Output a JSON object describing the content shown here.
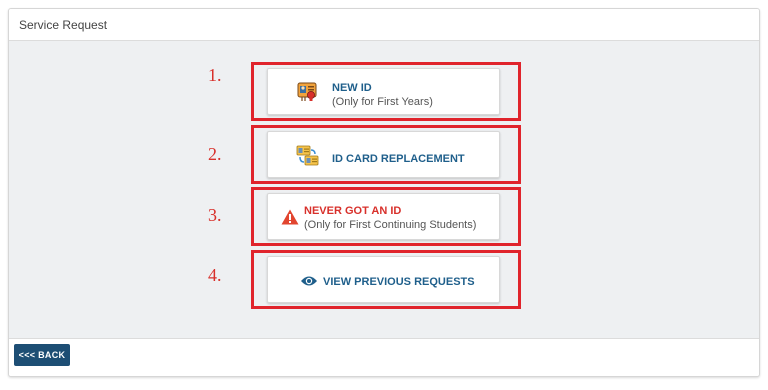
{
  "header": {
    "title": "Service Request"
  },
  "options": [
    {
      "number": "1.",
      "title": "NEW ID",
      "subtitle": "(Only for First Years)",
      "icon": "id-badge-icon"
    },
    {
      "number": "2.",
      "title": "ID CARD REPLACEMENT",
      "icon": "id-card-swap-icon"
    },
    {
      "number": "3.",
      "title": "NEVER GOT AN ID",
      "subtitle": "(Only for First Continuing Students)",
      "icon": "warning-triangle-icon"
    },
    {
      "number": "4.",
      "title": "VIEW PREVIOUS REQUESTS",
      "icon": "eye-icon"
    }
  ],
  "footer": {
    "back_label": "<<< BACK"
  },
  "colors": {
    "accent": "#1f5f8b",
    "warning": "#d8302b",
    "highlight": "#e0242c",
    "back_button": "#1d4e74"
  }
}
